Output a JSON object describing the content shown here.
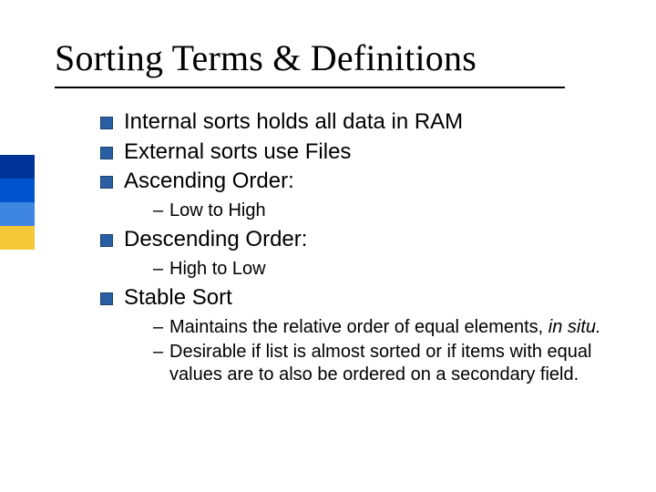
{
  "title": "Sorting Terms & Definitions",
  "bullets": {
    "b0": "Internal sorts holds all data in RAM",
    "b1": "External sorts use Files",
    "b2": "Ascending Order:",
    "b2_sub0": "Low to High",
    "b3": "Descending Order:",
    "b3_sub0": "High to Low",
    "b4": "Stable Sort",
    "b4_sub0_a": "Maintains the relative order of equal elements, ",
    "b4_sub0_b": "in situ.",
    "b4_sub1": "Desirable if list is almost sorted or if items with equal values are to also be ordered on a secondary field."
  }
}
